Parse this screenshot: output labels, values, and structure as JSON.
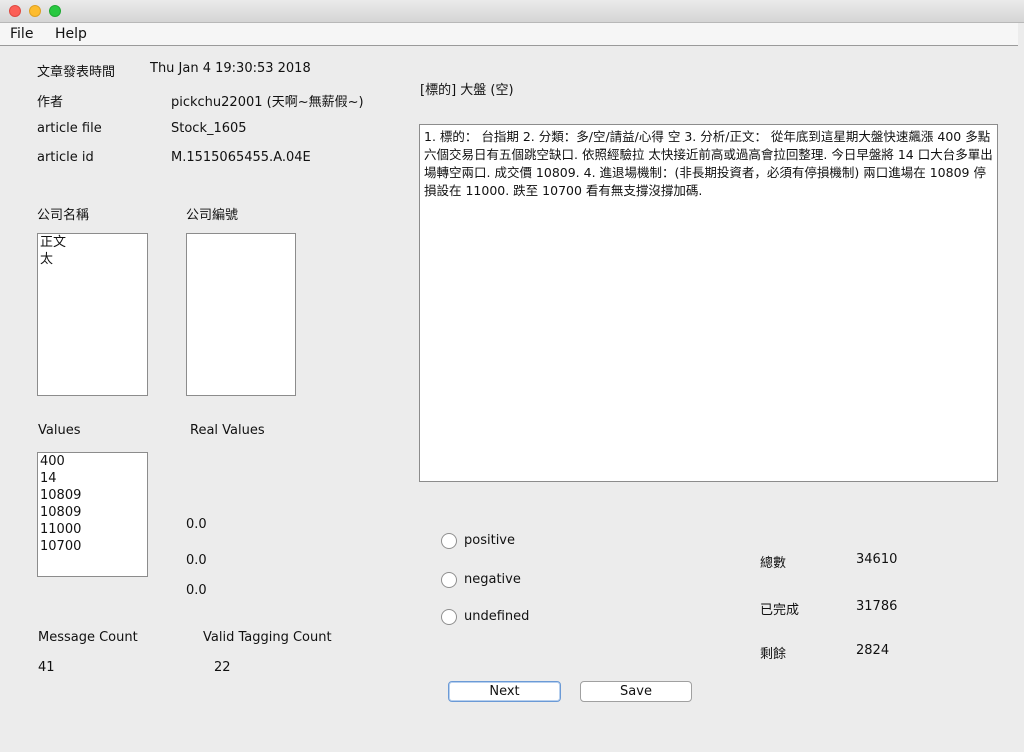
{
  "menu": {
    "file": "File",
    "help": "Help"
  },
  "meta": {
    "post_time_label": "文章發表時間",
    "post_time_value": "Thu Jan  4 19:30:53 2018",
    "author_label": "作者",
    "author_value": "pickchu22001 (天啊~無薪假~)",
    "article_file_label": "article file",
    "article_file_value": "Stock_1605",
    "article_id_label": "article id",
    "article_id_value": "M.1515065455.A.04E"
  },
  "article_title": "[標的] 大盤 (空)",
  "article_body": "1. 標的： 台指期 2. 分類：多/空/請益/心得 空 3. 分析/正文： 從年底到這星期大盤快速飆漲 400 多點六個交易日有五個跳空缺口. 依照經驗拉 太快接近前高或過高會拉回整理. 今日早盤將 14 口大台多單出場轉空兩口. 成交價 10809. 4. 進退場機制：(非長期投資者，必須有停損機制) 兩口進場在 10809 停損設在 11000. 跌至 10700 看有無支撐沒撐加碼.",
  "company_name": {
    "label": "公司名稱",
    "items": [
      "正文",
      "太"
    ]
  },
  "company_code": {
    "label": "公司編號",
    "items": []
  },
  "values": {
    "label": "Values",
    "items": [
      "400",
      "14",
      "10809",
      "10809",
      "11000",
      "10700"
    ]
  },
  "real_values": {
    "label": "Real Values",
    "items": [
      "0.0",
      "0.0",
      "0.0"
    ]
  },
  "sentiment": {
    "positive": "positive",
    "negative": "negative",
    "undefined": "undefined"
  },
  "stats": {
    "total_label": "總數",
    "total_value": "34610",
    "done_label": "已完成",
    "done_value": "31786",
    "remaining_label": "剩餘",
    "remaining_value": "2824"
  },
  "counts": {
    "message_label": "Message Count",
    "message_value": "41",
    "valid_label": "Valid Tagging Count",
    "valid_value": "22"
  },
  "buttons": {
    "next": "Next",
    "save": "Save"
  }
}
